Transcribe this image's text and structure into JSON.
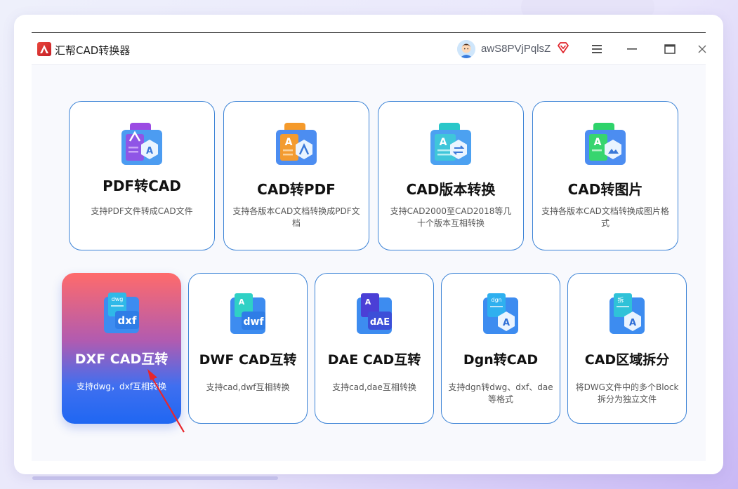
{
  "app": {
    "title": "汇帮CAD转换器",
    "username": "awS8PVjPqlsZ",
    "accent_color": "#3c83d6"
  },
  "titlebar": {
    "icons": [
      "app-logo-icon",
      "avatar-icon",
      "vip-diamond-icon",
      "menu-icon",
      "minimize-icon",
      "maximize-icon",
      "close-icon"
    ]
  },
  "cards_row1": [
    {
      "title": "PDF转CAD",
      "desc": "支持PDF文件转成CAD文件",
      "icon": "pdf-to-cad-icon"
    },
    {
      "title": "CAD转PDF",
      "desc": "支持各版本CAD文档转换成PDF文档",
      "icon": "cad-to-pdf-icon"
    },
    {
      "title": "CAD版本转换",
      "desc": "支持CAD2000至CAD2018等几十个版本互相转换",
      "icon": "cad-version-icon"
    },
    {
      "title": "CAD转图片",
      "desc": "支持各版本CAD文档转换成图片格式",
      "icon": "cad-to-image-icon"
    }
  ],
  "cards_row2": [
    {
      "title": "DXF CAD互转",
      "desc": "支持dwg，dxf互相转换",
      "icon": "dxf-icon",
      "badge": "dxf",
      "tag": "dwg",
      "active": true
    },
    {
      "title": "DWF CAD互转",
      "desc": "支持cad,dwf互相转换",
      "icon": "dwf-icon",
      "badge": "dwf"
    },
    {
      "title": "DAE CAD互转",
      "desc": "支持cad,dae互相转换",
      "icon": "dae-icon",
      "badge": "dAE"
    },
    {
      "title": "Dgn转CAD",
      "desc": "支持dgn转dwg、dxf、dae等格式",
      "icon": "dgn-icon",
      "tag": "dgn",
      "badge": "A"
    },
    {
      "title": "CAD区域拆分",
      "desc": "将DWG文件中的多个Block拆分为独立文件",
      "icon": "split-icon",
      "tag": "拆",
      "badge": "A"
    }
  ]
}
